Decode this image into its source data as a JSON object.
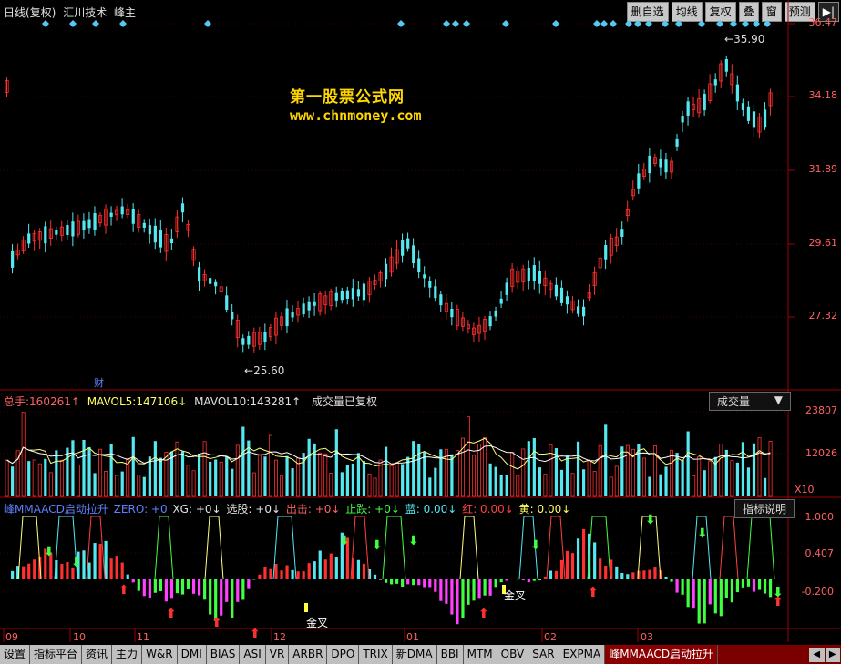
{
  "header": {
    "period": "日线(复权)",
    "name": "汇川技术",
    "formula": "峰主"
  },
  "toolbar": [
    {
      "label": "删自选",
      "name": "remove-watchlist-button"
    },
    {
      "label": "均线",
      "name": "ma-button"
    },
    {
      "label": "复权",
      "name": "restore-right-button"
    },
    {
      "label": "叠",
      "name": "overlay-button"
    },
    {
      "label": "窗",
      "name": "window-button"
    },
    {
      "label": "预测",
      "name": "forecast-button"
    },
    {
      "label": "▶|",
      "name": "play-button"
    }
  ],
  "watermark": {
    "line1": "第一股票公式网",
    "line2": "www.chnmoney.com"
  },
  "price_axis": [
    "36.47",
    "34.18",
    "31.89",
    "29.61",
    "27.32"
  ],
  "annotations": {
    "high": "35.90",
    "low": "25.60",
    "cai": "财"
  },
  "volume": {
    "title": "总手:",
    "total": "160261↑",
    "mavol5_lbl": "MAVOL5:",
    "mavol5": "147106↓",
    "mavol10_lbl": "MAVOL10:",
    "mavol10": "143281↑",
    "note": "成交量已复权",
    "button": "成交量",
    "axis": [
      "23807",
      "12026"
    ],
    "unit": "X10"
  },
  "indicator": {
    "name": "峰MMAACD启动拉升",
    "zero": "ZERO: +0",
    "xg": "XG: +0↓",
    "xuan": "选股: +0↓",
    "chuji": "出击: +0↓",
    "zhidie": "止跌: +0↓",
    "lan": "蓝: 0.00↓",
    "hong": "红: 0.00↓",
    "huang": "黄: 0.00↓",
    "button": "指标说明",
    "axis": [
      "1.000",
      "0.407",
      "-0.200"
    ],
    "labels": [
      "金叉",
      "金叉"
    ]
  },
  "dates": [
    "09",
    "10",
    "11",
    "12",
    "01",
    "02",
    "03"
  ],
  "bottom_tabs": [
    "设置",
    "指标平台",
    "资讯",
    "主力",
    "W&R",
    "DMI",
    "BIAS",
    "ASI",
    "VR",
    "ARBR",
    "DPO",
    "TRIX",
    "新DMA",
    "BBI",
    "MTM",
    "OBV",
    "SAR",
    "EXPMA",
    "峰MMAACD启动拉升"
  ],
  "colors": {
    "up": "#ff3030",
    "down": "#54e8f0",
    "magenta": "#ff40ff",
    "green": "#40ff40",
    "yellow": "#ffff80",
    "gold": "#ffd700"
  }
}
